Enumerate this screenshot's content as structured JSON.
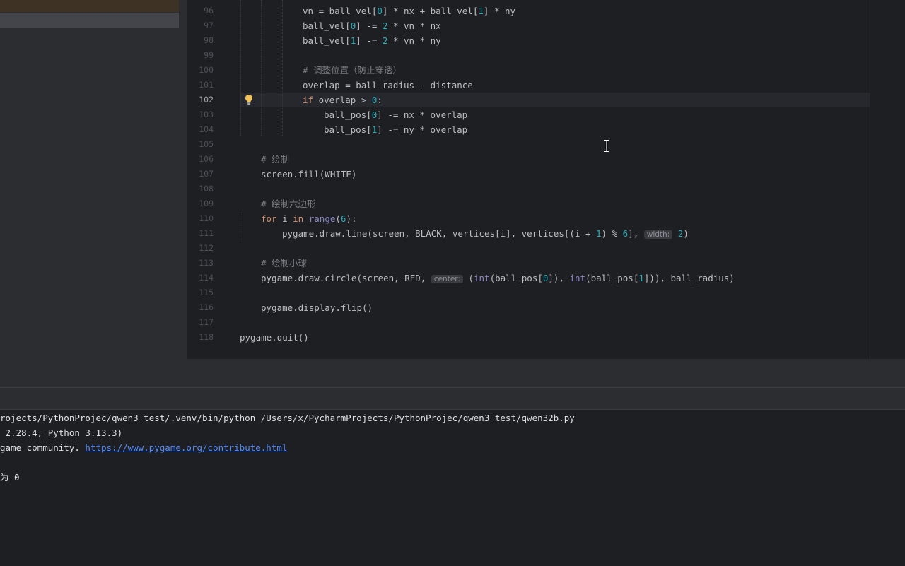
{
  "editor": {
    "current_line": "102",
    "lines": [
      {
        "no": "96",
        "segs": [
          [
            "vn = ball_vel[",
            ""
          ],
          [
            "0",
            "num"
          ],
          [
            "] * nx + ball_vel[",
            ""
          ],
          [
            "1",
            "num"
          ],
          [
            "] * ny",
            ""
          ]
        ]
      },
      {
        "no": "97",
        "segs": [
          [
            "ball_vel[",
            ""
          ],
          [
            "0",
            "num"
          ],
          [
            "] -= ",
            ""
          ],
          [
            "2",
            "num"
          ],
          [
            " * vn * nx",
            ""
          ]
        ]
      },
      {
        "no": "98",
        "segs": [
          [
            "ball_vel[",
            ""
          ],
          [
            "1",
            "num"
          ],
          [
            "] -= ",
            ""
          ],
          [
            "2",
            "num"
          ],
          [
            " * vn * ny",
            ""
          ]
        ]
      },
      {
        "no": "99",
        "segs": []
      },
      {
        "no": "100",
        "segs": [
          [
            "# 调整位置（防止穿透）",
            "cm"
          ]
        ]
      },
      {
        "no": "101",
        "segs": [
          [
            "overlap = ball_radius - distance",
            ""
          ]
        ]
      },
      {
        "no": "102",
        "segs": [
          [
            "if",
            "kw"
          ],
          [
            " overlap > ",
            ""
          ],
          [
            "0",
            "num"
          ],
          [
            ":",
            ""
          ]
        ]
      },
      {
        "no": "103",
        "segs": [
          [
            "ball_pos[",
            ""
          ],
          [
            "0",
            "num"
          ],
          [
            "] -= nx * overlap",
            ""
          ]
        ]
      },
      {
        "no": "104",
        "segs": [
          [
            "ball_pos[",
            ""
          ],
          [
            "1",
            "num"
          ],
          [
            "] -= ny * overlap",
            ""
          ]
        ]
      },
      {
        "no": "105",
        "segs": []
      },
      {
        "no": "106",
        "segs": [
          [
            "# 绘制",
            "cm"
          ]
        ]
      },
      {
        "no": "107",
        "segs": [
          [
            "screen.fill(WHITE)",
            ""
          ]
        ]
      },
      {
        "no": "108",
        "segs": []
      },
      {
        "no": "109",
        "segs": [
          [
            "# 绘制六边形",
            "cm"
          ]
        ]
      },
      {
        "no": "110",
        "segs": [
          [
            "for",
            "kw"
          ],
          [
            " i ",
            ""
          ],
          [
            "in",
            "kw"
          ],
          [
            " ",
            ""
          ],
          [
            "range",
            "bi"
          ],
          [
            "(",
            ""
          ],
          [
            "6",
            "num"
          ],
          [
            "):",
            ""
          ]
        ]
      },
      {
        "no": "111",
        "segs": [
          [
            "pygame.draw.line(screen, BLACK, vertices[i], vertices[(i + ",
            ""
          ],
          [
            "1",
            "num"
          ],
          [
            ") % ",
            ""
          ],
          [
            "6",
            "num"
          ],
          [
            "], ",
            ""
          ],
          [
            "width:",
            "hint"
          ],
          [
            " ",
            ""
          ],
          [
            "2",
            "num"
          ],
          [
            ")",
            ""
          ]
        ]
      },
      {
        "no": "112",
        "segs": []
      },
      {
        "no": "113",
        "segs": [
          [
            "# 绘制小球",
            "cm"
          ]
        ]
      },
      {
        "no": "114",
        "segs": [
          [
            "pygame.draw.circle(screen, RED, ",
            ""
          ],
          [
            "center:",
            "hint"
          ],
          [
            " (",
            ""
          ],
          [
            "int",
            "bi"
          ],
          [
            "(ball_pos[",
            ""
          ],
          [
            "0",
            "num"
          ],
          [
            "]), ",
            ""
          ],
          [
            "int",
            "bi"
          ],
          [
            "(ball_pos[",
            ""
          ],
          [
            "1",
            "num"
          ],
          [
            "])), ball_radius)",
            ""
          ]
        ]
      },
      {
        "no": "115",
        "segs": []
      },
      {
        "no": "116",
        "segs": [
          [
            "pygame.display.flip()",
            ""
          ]
        ]
      },
      {
        "no": "117",
        "segs": []
      },
      {
        "no": "118",
        "segs": [
          [
            "pygame.quit()",
            ""
          ]
        ]
      }
    ]
  },
  "terminal": {
    "line1": "rojects/PythonProjec/qwen3_test/.venv/bin/python /Users/x/PycharmProjects/PythonProjec/qwen3_test/qwen32b.py",
    "line2": " 2.28.4, Python 3.13.3)",
    "line3_prefix": "game community. ",
    "line3_link": "https://www.pygame.org/contribute.html",
    "line5": "为 0"
  },
  "colors": {
    "background": "#1e1f22",
    "keyword": "#cf8e6d",
    "number": "#2aacb8",
    "comment": "#7a7e85",
    "builtin": "#8888c6",
    "link": "#548af7",
    "bulb": "#f2c55c"
  },
  "icons": {
    "gutter_action": "lightbulb-icon",
    "mouse_cursor": "text-cursor-icon"
  }
}
